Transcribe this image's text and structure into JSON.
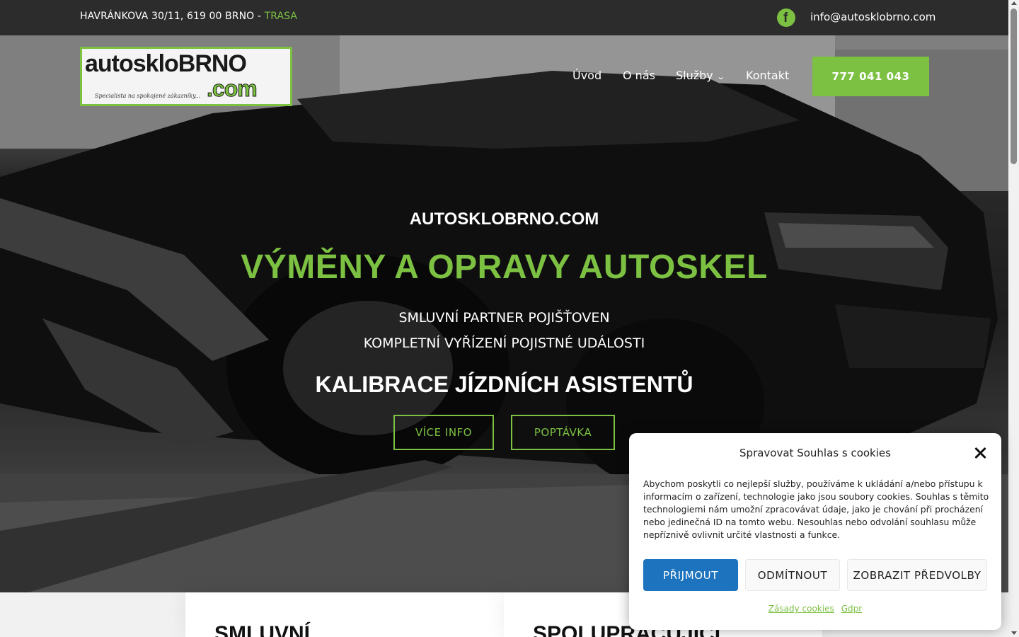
{
  "topbar": {
    "address": "HAVRÁNKOVA 30/11, 619 00 BRNO - ",
    "route_link": "TRASA",
    "facebook_glyph": "f",
    "email": "info@autosklobrno.com"
  },
  "logo": {
    "line1": "autoskloBRNO",
    "line2": ".com",
    "tagline": "Specialista na spokojené zákazníky..."
  },
  "nav": {
    "items": [
      "Úvod",
      "O nás",
      "Služby",
      "Kontakt"
    ],
    "submenu_glyph": "⌄",
    "phone": "777 041 043"
  },
  "hero": {
    "subtitle": "AUTOSKLOBRNO.COM",
    "headline": "VÝMĚNY A OPRAVY AUTOSKEL",
    "line1": "SMLUVNÍ PARTNER POJIŠŤOVEN",
    "line2": "KOMPLETNÍ VYŘÍZENÍ POJISTNÉ UDÁLOSTI",
    "calibration": "KALIBRACE JÍZDNÍCH ASISTENTŮ",
    "btn_info": "VÍCE INFO",
    "btn_inquiry": "POPTÁVKA"
  },
  "lower": {
    "card1_title": "SMLUVNÍ",
    "card2_title": "SPOLUPRACUJÍCÍ"
  },
  "cookie": {
    "title": "Spravovat Souhlas s cookies",
    "text": "Abychom poskytli co nejlepší služby, používáme k ukládání a/nebo přístupu k informacím o zařízení, technologie jako jsou soubory cookies. Souhlas s těmito technologiemi nám umožní zpracovávat údaje, jako je chování při procházení nebo jedinečná ID na tomto webu. Nesouhlas nebo odvolání souhlasu může nepříznivě ovlivnit určité vlastnosti a funkce.",
    "accept": "PŘIJMOUT",
    "deny": "ODMÍTNOUT",
    "preferences": "ZOBRAZIT PŘEDVOLBY",
    "link_policy": "Zásady cookies",
    "link_gdpr": "Gdpr"
  },
  "colors": {
    "brand_green": "#7cc142",
    "accept_blue": "#1e73be",
    "topbar_bg": "#2c2c2c"
  }
}
